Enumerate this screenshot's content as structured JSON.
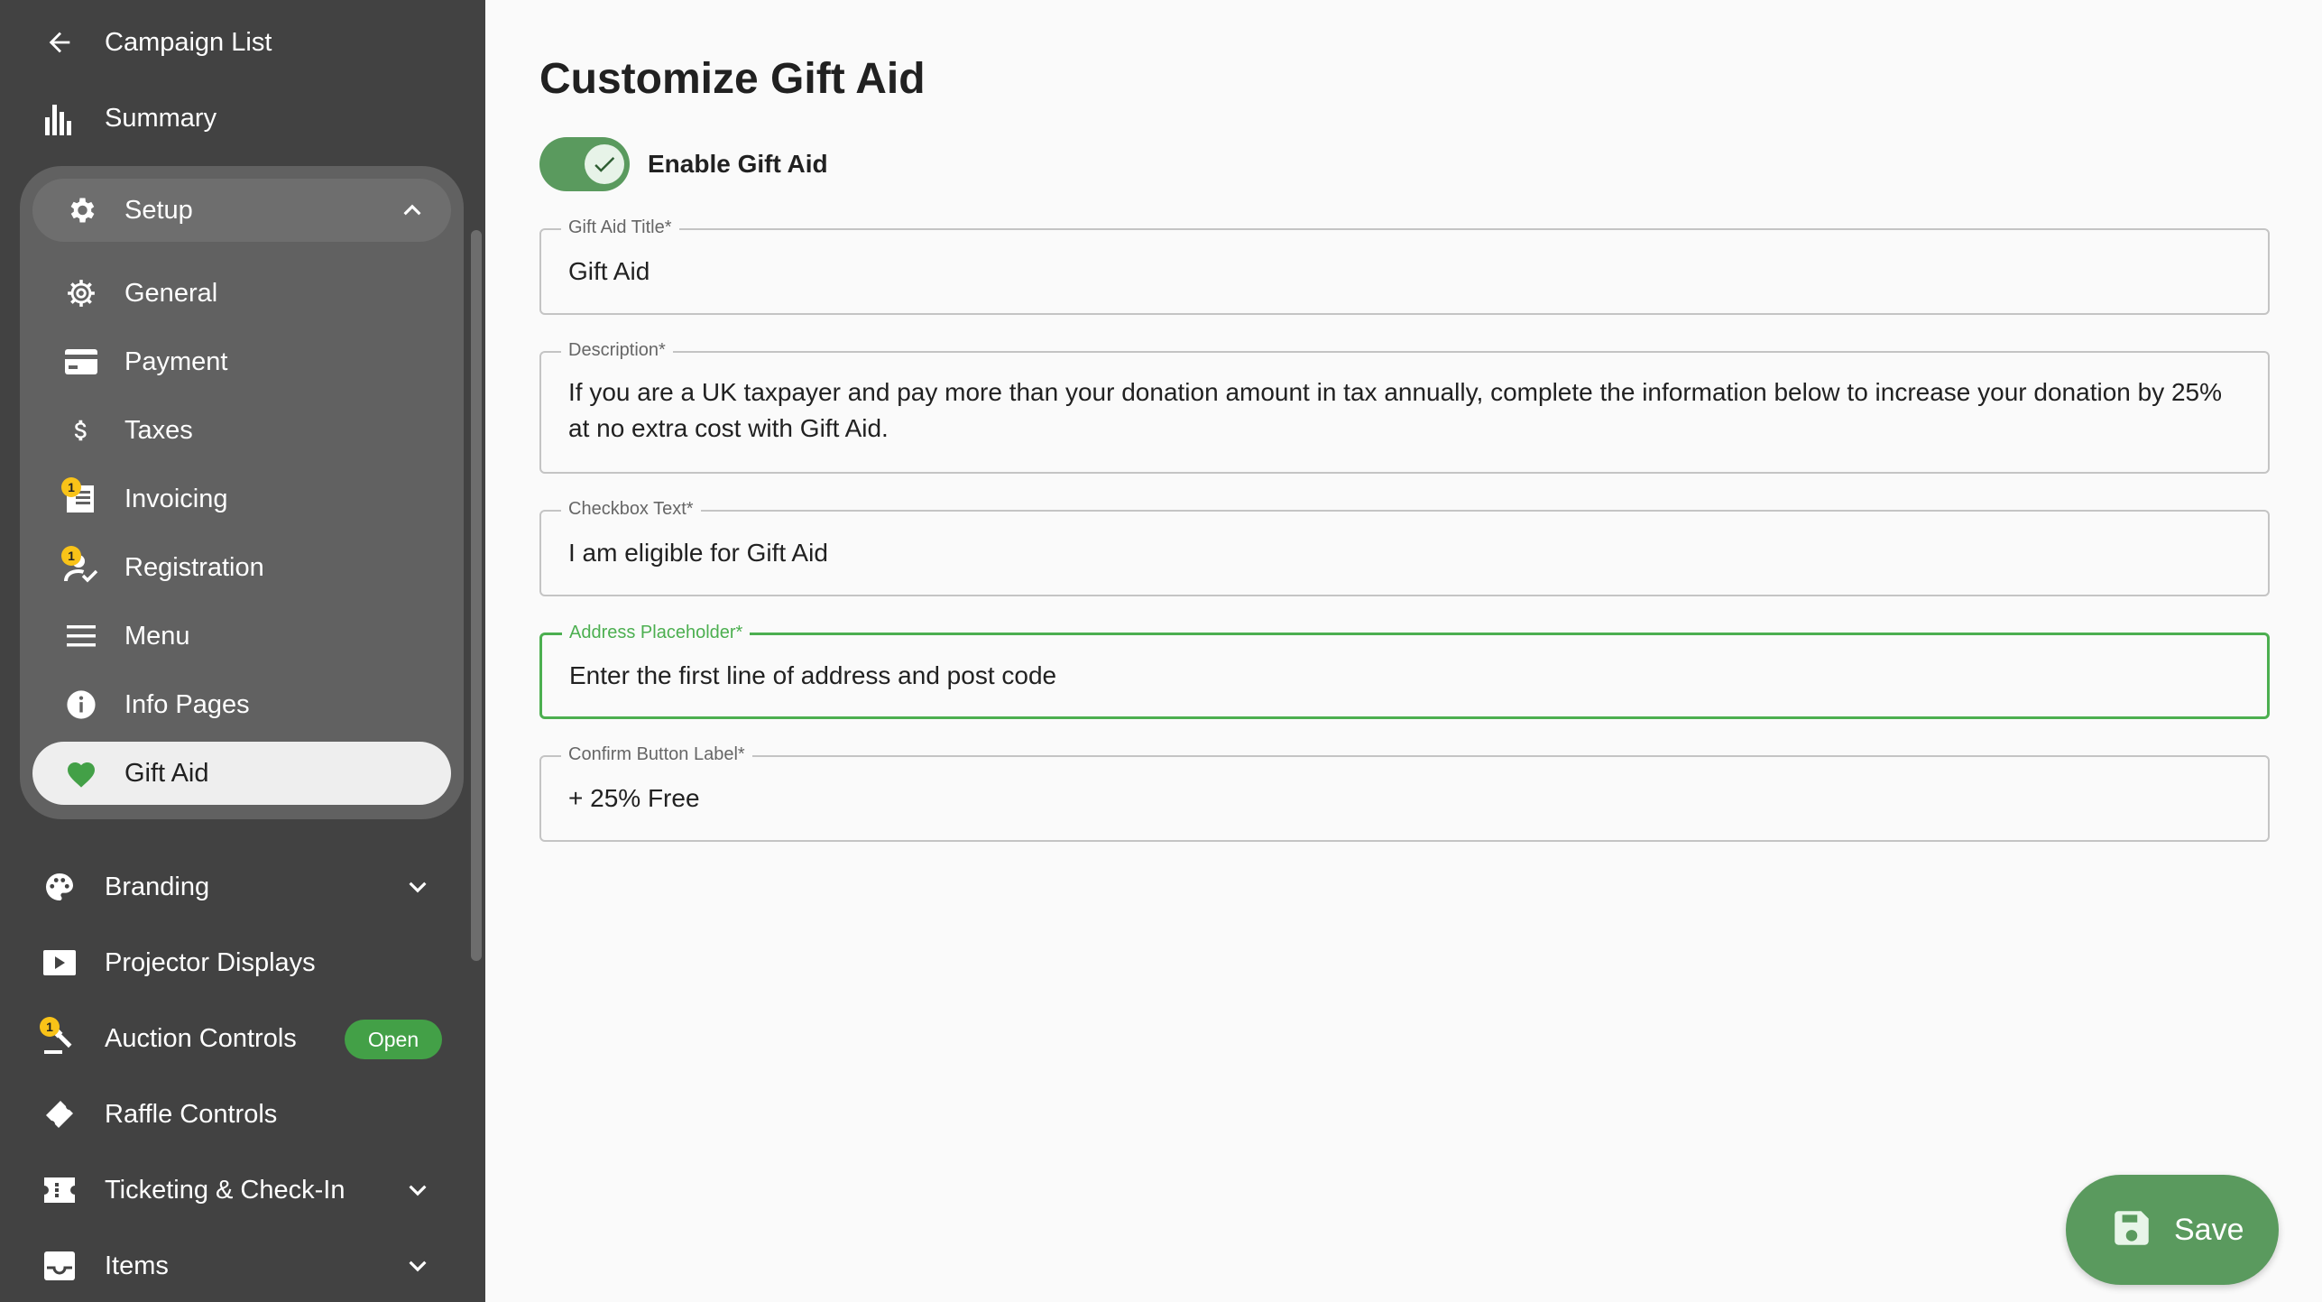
{
  "sidebar": {
    "back": {
      "label": "Campaign List",
      "icon": "arrow-left-icon"
    },
    "summary": {
      "label": "Summary",
      "icon": "bar-chart-icon"
    },
    "setup": {
      "label": "Setup",
      "icon": "gear-icon",
      "expanded": true,
      "items": [
        {
          "label": "General",
          "icon": "gear-outline-icon"
        },
        {
          "label": "Payment",
          "icon": "credit-card-icon"
        },
        {
          "label": "Taxes",
          "icon": "dollar-icon"
        },
        {
          "label": "Invoicing",
          "icon": "invoice-icon",
          "badge": "1"
        },
        {
          "label": "Registration",
          "icon": "person-check-icon",
          "badge": "1"
        },
        {
          "label": "Menu",
          "icon": "menu-lines-icon"
        },
        {
          "label": "Info Pages",
          "icon": "info-icon"
        },
        {
          "label": "Gift Aid",
          "icon": "heart-icon",
          "active": true
        }
      ]
    },
    "branding": {
      "label": "Branding",
      "icon": "palette-icon"
    },
    "projector": {
      "label": "Projector Displays",
      "icon": "play-icon"
    },
    "auction": {
      "label": "Auction Controls",
      "icon": "gavel-icon",
      "badge": "1",
      "status": "Open"
    },
    "raffle": {
      "label": "Raffle Controls",
      "icon": "ticket-icon"
    },
    "ticketing": {
      "label": "Ticketing & Check-In",
      "icon": "ticket-stub-icon"
    },
    "items": {
      "label": "Items",
      "icon": "inbox-icon"
    }
  },
  "main": {
    "title": "Customize Gift Aid",
    "toggle": {
      "label": "Enable Gift Aid",
      "checked": true
    },
    "fields": {
      "title": {
        "label": "Gift Aid Title*",
        "value": "Gift Aid"
      },
      "description": {
        "label": "Description*",
        "value": "If you are a UK taxpayer and pay more than your donation amount in tax annually, complete the information below to increase your donation by 25% at no extra cost with Gift Aid."
      },
      "checkbox": {
        "label": "Checkbox Text*",
        "value": "I am eligible for Gift Aid"
      },
      "address": {
        "label": "Address Placeholder*",
        "value": "Enter the first line of address and post code",
        "focused": true
      },
      "confirm": {
        "label": "Confirm Button Label*",
        "value": "+ 25% Free"
      }
    },
    "save_label": "Save"
  },
  "colors": {
    "sidebar_bg": "#424242",
    "accent_green": "#4caf50",
    "badge_yellow": "#f9c318"
  }
}
